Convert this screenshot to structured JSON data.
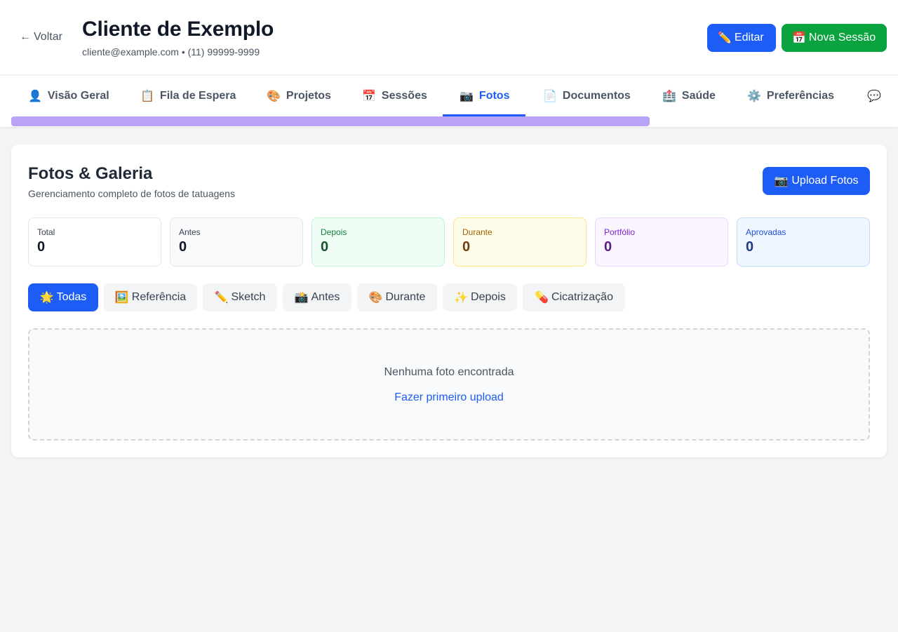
{
  "header": {
    "back_label": "Voltar",
    "back_arrow": "←",
    "client_name": "Cliente de Exemplo",
    "contact": "cliente@example.com • (11) 99999-9999",
    "edit_button": {
      "icon": "✏️",
      "label": "Editar"
    },
    "session_button": {
      "icon": "📅",
      "label": "Nova Sessão"
    }
  },
  "tabs": [
    {
      "icon": "👤",
      "label": "Visão Geral"
    },
    {
      "icon": "📋",
      "label": "Fila de Espera"
    },
    {
      "icon": "🎨",
      "label": "Projetos"
    },
    {
      "icon": "📅",
      "label": "Sessões"
    },
    {
      "icon": "📷",
      "label": "Fotos"
    },
    {
      "icon": "📄",
      "label": "Documentos"
    },
    {
      "icon": "🏥",
      "label": "Saúde"
    },
    {
      "icon": "⚙️",
      "label": "Preferências"
    },
    {
      "icon": "💬",
      "label": ""
    }
  ],
  "active_tab": "Fotos",
  "gallery": {
    "title": "Fotos & Galeria",
    "subtitle": "Gerenciamento completo de fotos de tatuagens",
    "upload_button": {
      "icon": "📷",
      "label": "Upload Fotos"
    },
    "stats": [
      {
        "label": "Total",
        "value": "0"
      },
      {
        "label": "Antes",
        "value": "0"
      },
      {
        "label": "Depois",
        "value": "0"
      },
      {
        "label": "Durante",
        "value": "0"
      },
      {
        "label": "Portfólio",
        "value": "0"
      },
      {
        "label": "Aprovadas",
        "value": "0"
      }
    ],
    "filters": [
      {
        "icon": "🌟",
        "label": "Todas"
      },
      {
        "icon": "🖼️",
        "label": "Referência"
      },
      {
        "icon": "✏️",
        "label": "Sketch"
      },
      {
        "icon": "📸",
        "label": "Antes"
      },
      {
        "icon": "🎨",
        "label": "Durante"
      },
      {
        "icon": "✨",
        "label": "Depois"
      },
      {
        "icon": "💊",
        "label": "Cicatrização"
      }
    ],
    "active_filter": "Todas",
    "empty_state": {
      "message": "Nenhuma foto encontrada",
      "action": "Fazer primeiro upload"
    }
  },
  "colors": {
    "primary": "#1d5cf5",
    "success": "#0aa340",
    "scrollbar": "#b9a3f5"
  }
}
